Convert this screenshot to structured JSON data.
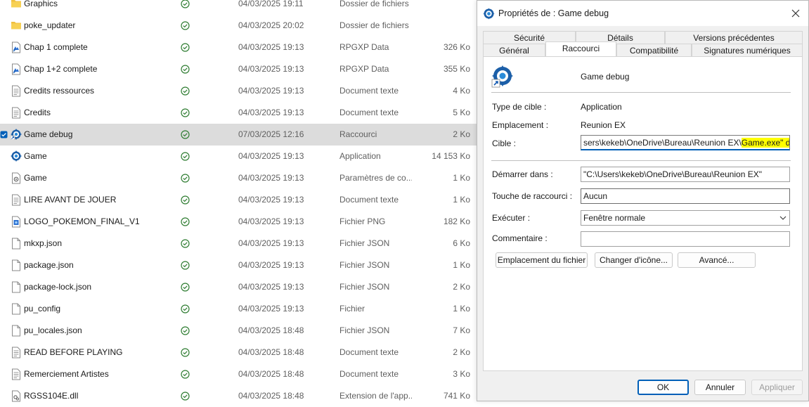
{
  "files": [
    {
      "name": "Graphics",
      "date": "04/03/2025 19:11",
      "type": "Dossier de fichiers",
      "size": "",
      "icon": "folder-icon",
      "selected": false
    },
    {
      "name": "poke_updater",
      "date": "04/03/2025 20:02",
      "type": "Dossier de fichiers",
      "size": "",
      "icon": "folder-icon",
      "selected": false
    },
    {
      "name": "Chap 1 complete",
      "date": "04/03/2025 19:13",
      "type": "RPGXP Data",
      "size": "326 Ko",
      "icon": "rpgxp-file-icon",
      "selected": false
    },
    {
      "name": "Chap 1+2 complete",
      "date": "04/03/2025 19:13",
      "type": "RPGXP Data",
      "size": "355 Ko",
      "icon": "rpgxp-file-icon",
      "selected": false
    },
    {
      "name": "Credits ressources",
      "date": "04/03/2025 19:13",
      "type": "Document texte",
      "size": "4 Ko",
      "icon": "text-file-icon",
      "selected": false
    },
    {
      "name": "Credits",
      "date": "04/03/2025 19:13",
      "type": "Document texte",
      "size": "5 Ko",
      "icon": "text-file-icon",
      "selected": false
    },
    {
      "name": "Game debug",
      "date": "07/03/2025 12:16",
      "type": "Raccourci",
      "size": "2 Ko",
      "icon": "shortcut-game-icon",
      "selected": true
    },
    {
      "name": "Game",
      "date": "04/03/2025 19:13",
      "type": "Application",
      "size": "14 153 Ko",
      "icon": "game-app-icon",
      "selected": false
    },
    {
      "name": "Game",
      "date": "04/03/2025 19:13",
      "type": "Paramètres de co...",
      "size": "1 Ko",
      "icon": "config-file-icon",
      "selected": false
    },
    {
      "name": "LIRE AVANT DE JOUER",
      "date": "04/03/2025 19:13",
      "type": "Document texte",
      "size": "1 Ko",
      "icon": "text-file-icon",
      "selected": false
    },
    {
      "name": "LOGO_POKEMON_FINAL_V1",
      "date": "04/03/2025 19:13",
      "type": "Fichier PNG",
      "size": "182 Ko",
      "icon": "image-file-icon",
      "selected": false
    },
    {
      "name": "mkxp.json",
      "date": "04/03/2025 19:13",
      "type": "Fichier JSON",
      "size": "6 Ko",
      "icon": "file-icon",
      "selected": false
    },
    {
      "name": "package.json",
      "date": "04/03/2025 19:13",
      "type": "Fichier JSON",
      "size": "1 Ko",
      "icon": "file-icon",
      "selected": false
    },
    {
      "name": "package-lock.json",
      "date": "04/03/2025 19:13",
      "type": "Fichier JSON",
      "size": "2 Ko",
      "icon": "file-icon",
      "selected": false
    },
    {
      "name": "pu_config",
      "date": "04/03/2025 19:13",
      "type": "Fichier",
      "size": "1 Ko",
      "icon": "file-icon",
      "selected": false
    },
    {
      "name": "pu_locales.json",
      "date": "04/03/2025 18:48",
      "type": "Fichier JSON",
      "size": "7 Ko",
      "icon": "file-icon",
      "selected": false
    },
    {
      "name": "READ BEFORE PLAYING",
      "date": "04/03/2025 18:48",
      "type": "Document texte",
      "size": "2 Ko",
      "icon": "text-file-icon",
      "selected": false
    },
    {
      "name": "Remerciement Artistes",
      "date": "04/03/2025 18:48",
      "type": "Document texte",
      "size": "3 Ko",
      "icon": "text-file-icon",
      "selected": false
    },
    {
      "name": "RGSS104E.dll",
      "date": "04/03/2025 18:48",
      "type": "Extension de l'app...",
      "size": "741 Ko",
      "icon": "dll-file-icon",
      "selected": false
    }
  ],
  "dialog": {
    "title": "Propriétés de : Game debug",
    "close_icon": "close-icon",
    "tabs_row1": [
      "Sécurité",
      "Détails",
      "Versions précédentes"
    ],
    "tabs_row2": [
      "Général",
      "Raccourci",
      "Compatibilité",
      "Signatures numériques"
    ],
    "active_tab": "Raccourci",
    "shortcut_name": "Game debug",
    "target_type_label": "Type de cible :",
    "target_type_value": "Application",
    "location_label": "Emplacement :",
    "location_value": "Reunion EX",
    "target_label": "Cible :",
    "target_value_prefix": "sers\\kekeb\\OneDrive\\Bureau\\Reunion EX\\",
    "target_value_highlight": "Game.exe\" debug",
    "start_in_label": "Démarrer dans :",
    "start_in_value": "\"C:\\Users\\kekeb\\OneDrive\\Bureau\\Reunion EX\"",
    "hotkey_label": "Touche de raccourci :",
    "hotkey_value": "Aucun",
    "run_label": "Exécuter :",
    "run_value": "Fenêtre normale",
    "comment_label": "Commentaire :",
    "comment_value": "",
    "btn_open_location": "Emplacement du fichier",
    "btn_change_icon": "Changer d'icône...",
    "btn_advanced": "Avancé...",
    "btn_ok": "OK",
    "btn_cancel": "Annuler",
    "btn_apply": "Appliquer"
  },
  "colors": {
    "accent": "#005fb8",
    "sync_green": "#2f7d32",
    "folder_yellow": "#f0c040",
    "highlight": "#ffff00",
    "selected_row": "#dcdcdc"
  }
}
